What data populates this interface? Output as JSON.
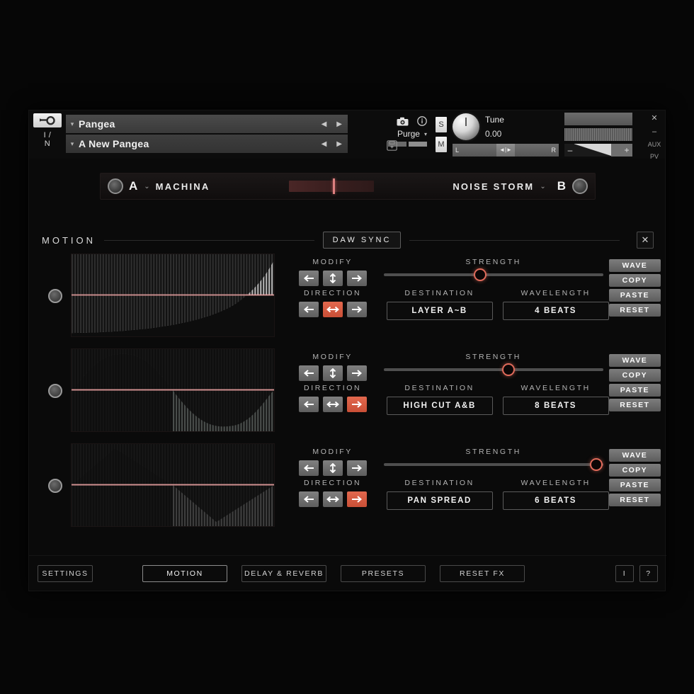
{
  "header": {
    "tools_icon": "wrench-icon",
    "io_label": "I /\nN",
    "io_line1": "I /",
    "io_line2": "N",
    "rack_name": "Pangea",
    "instrument_name": "A New Pangea",
    "snapshot_icon": "camera-icon",
    "info_icon": "info-icon",
    "save_icon": "save-icon",
    "prev_icon": "prev-arrow-icon",
    "next_icon": "next-arrow-icon",
    "purge_label": "Purge",
    "purge_caret": "▾",
    "solo_label": "S",
    "mute_label": "M",
    "tune_label": "Tune",
    "tune_value": "0.00",
    "pan_left": "L",
    "pan_right": "R",
    "volume_minus": "–",
    "volume_plus": "+",
    "side_close": "✕",
    "side_minimize": "–",
    "side_aux": "AUX",
    "side_pv": "PV"
  },
  "ab_bar": {
    "slot_a_letter": "A",
    "slot_a_caret": "⌄",
    "slot_a_name": "MACHINA",
    "slot_b_name": "NOISE STORM",
    "slot_b_caret": "⌄",
    "slot_b_letter": "B",
    "crossfade_position_pct": 52
  },
  "motion": {
    "title": "MOTION",
    "daw_sync_label": "DAW SYNC",
    "close_label": "✕",
    "labels": {
      "modify": "MODIFY",
      "direction": "DIRECTION",
      "strength": "STRENGTH",
      "destination": "DESTINATION",
      "wavelength": "WAVELENGTH"
    },
    "actions": {
      "wave": "WAVE",
      "copy": "COPY",
      "paste": "PASTE",
      "reset": "RESET"
    },
    "rows": [
      {
        "enabled": true,
        "waveform": "ramp-up",
        "strength_pct": 44,
        "modify_active": "none",
        "direction_active": "both",
        "destination": "LAYER A~B",
        "wavelength": "4 BEATS"
      },
      {
        "enabled": true,
        "waveform": "sine",
        "strength_pct": 57,
        "modify_active": "none",
        "direction_active": "right",
        "destination": "HIGH CUT A&B",
        "wavelength": "8 BEATS"
      },
      {
        "enabled": true,
        "waveform": "triangle",
        "strength_pct": 97,
        "modify_active": "none",
        "direction_active": "right",
        "destination": "PAN SPREAD",
        "wavelength": "6 BEATS"
      }
    ]
  },
  "toolbar": {
    "settings": "SETTINGS",
    "motion": "MOTION",
    "delay_reverb": "DELAY & REVERB",
    "presets": "PRESETS",
    "reset_fx": "RESET FX",
    "info": "I",
    "help": "?"
  },
  "colors": {
    "accent_red": "#e06a5a",
    "accent_orange": "#d9593c",
    "panel_bg": "#0a0a0a",
    "text_primary": "#f0f0f0",
    "text_dim": "#b4b4b4"
  }
}
